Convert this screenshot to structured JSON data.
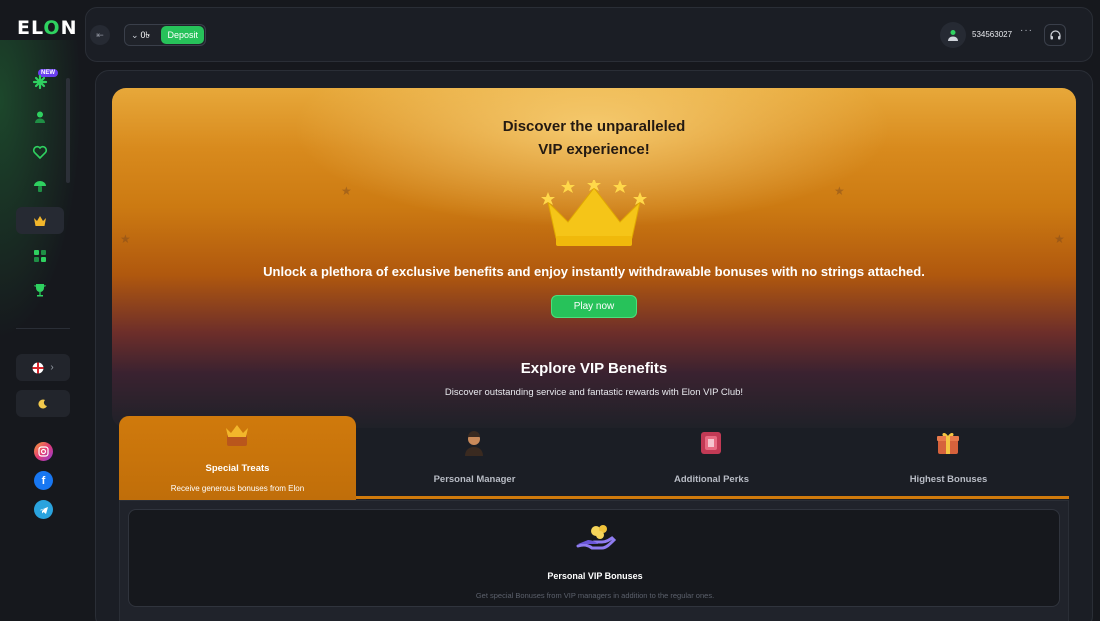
{
  "brand": {
    "logo_text_pre": "EL",
    "logo_text_o": "O",
    "logo_text_post": "N"
  },
  "sidebar": {
    "new_badge": "NEW",
    "items": [
      {
        "name": "casino",
        "icon": "clover-icon",
        "active": false
      },
      {
        "name": "live",
        "icon": "person-icon",
        "active": false
      },
      {
        "name": "favorites",
        "icon": "heart-icon",
        "active": false
      },
      {
        "name": "sports",
        "icon": "mushroom-icon",
        "active": false
      },
      {
        "name": "vip",
        "icon": "crown-icon",
        "active": true
      },
      {
        "name": "games",
        "icon": "grid-icon",
        "active": false
      },
      {
        "name": "tournaments",
        "icon": "trophy-icon",
        "active": false
      }
    ],
    "language_icon": "england-flag-icon",
    "theme_icon": "moon-icon",
    "socials": [
      "instagram-icon",
      "facebook-icon",
      "telegram-icon"
    ]
  },
  "header": {
    "currency": "0৳",
    "deposit_label": "Deposit",
    "user_id": "534563027",
    "more": "···"
  },
  "hero": {
    "title_line1": "Discover the unparalleled",
    "title_line2": "VIP experience!",
    "subtitle": "Unlock a plethora of exclusive benefits and enjoy instantly withdrawable bonuses with no strings attached.",
    "cta": "Play now"
  },
  "explore": {
    "title": "Explore VIP Benefits",
    "subtitle": "Discover outstanding service and fantastic rewards with Elon VIP Club!"
  },
  "tabs": [
    {
      "label": "Special Treats",
      "desc": "Receive generous bonuses from Elon",
      "icon": "crown-gift-icon",
      "active": true
    },
    {
      "label": "Personal Manager",
      "icon": "manager-icon",
      "active": false
    },
    {
      "label": "Additional Perks",
      "icon": "ticket-icon",
      "active": false
    },
    {
      "label": "Highest Bonuses",
      "icon": "gift-icon",
      "active": false
    }
  ],
  "card": {
    "title": "Personal VIP Bonuses",
    "desc": "Get special Bonuses from VIP managers in addition to the regular ones."
  },
  "colors": {
    "accent_green": "#27c25a",
    "accent_orange": "#d07a0c",
    "background": "#16181d"
  }
}
